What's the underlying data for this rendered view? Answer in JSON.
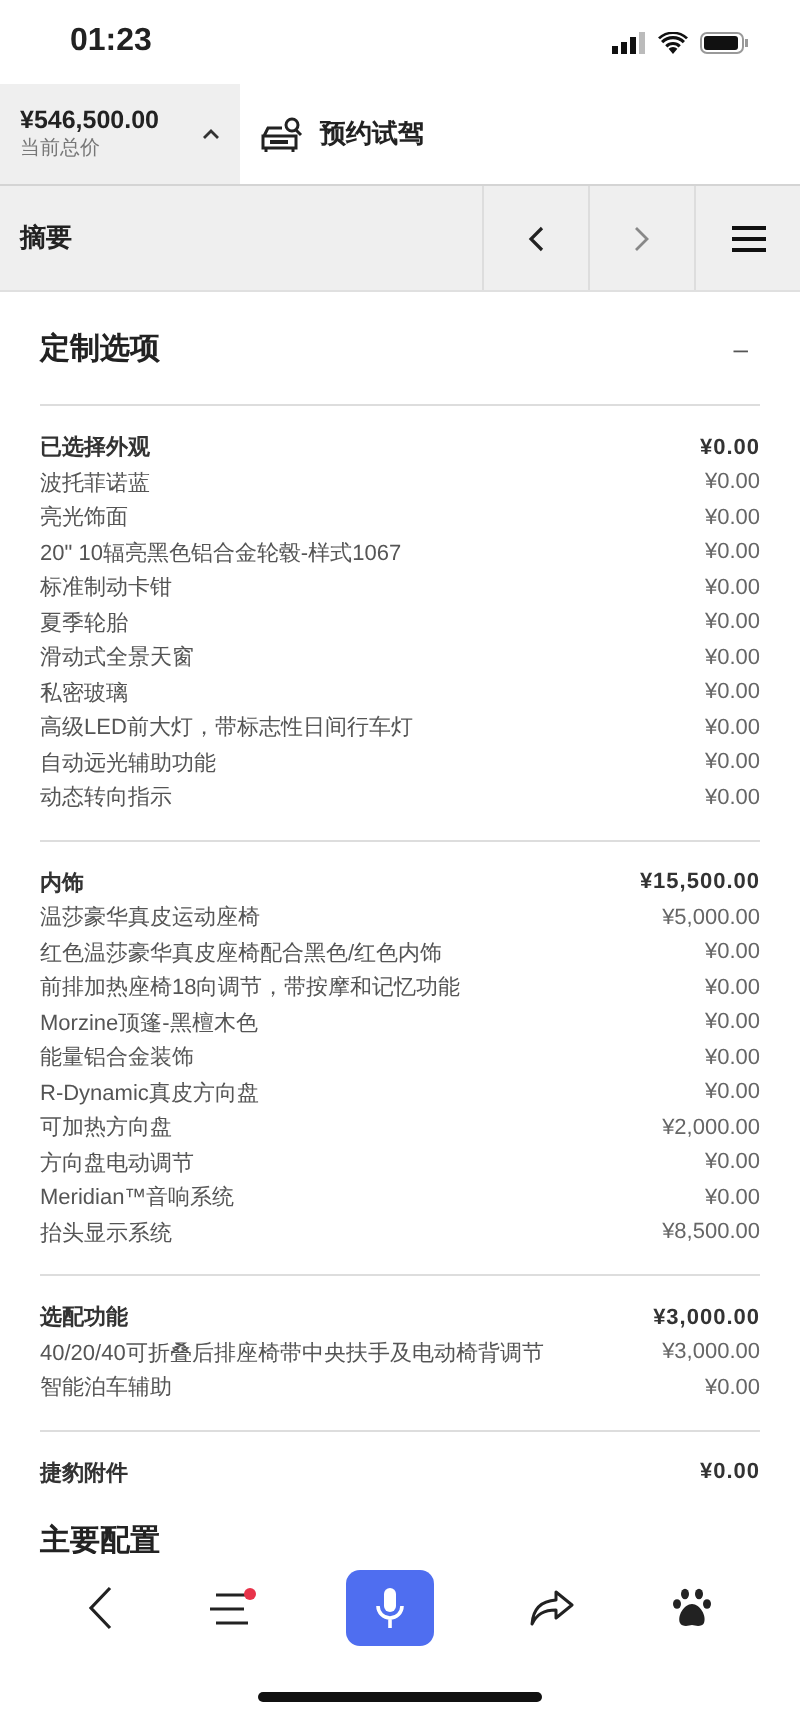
{
  "status_bar": {
    "time": "01:23"
  },
  "price_bar": {
    "total": "¥546,500.00",
    "total_label": "当前总价",
    "test_drive": "预约试驾"
  },
  "nav": {
    "title": "摘要"
  },
  "section": {
    "title": "定制选项",
    "collapse_symbol": "–"
  },
  "groups": [
    {
      "title": "已选择外观",
      "total": "¥0.00",
      "items": [
        {
          "name": "波托菲诺蓝",
          "price": "¥0.00"
        },
        {
          "name": "亮光饰面",
          "price": "¥0.00"
        },
        {
          "name": "20\" 10辐亮黑色铝合金轮毂-样式1067",
          "price": "¥0.00"
        },
        {
          "name": "标准制动卡钳",
          "price": "¥0.00"
        },
        {
          "name": "夏季轮胎",
          "price": "¥0.00"
        },
        {
          "name": "滑动式全景天窗",
          "price": "¥0.00"
        },
        {
          "name": "私密玻璃",
          "price": "¥0.00"
        },
        {
          "name": "高级LED前大灯，带标志性日间行车灯",
          "price": "¥0.00"
        },
        {
          "name": "自动远光辅助功能",
          "price": "¥0.00"
        },
        {
          "name": "动态转向指示",
          "price": "¥0.00"
        }
      ]
    },
    {
      "title": "内饰",
      "total": "¥15,500.00",
      "items": [
        {
          "name": "温莎豪华真皮运动座椅",
          "price": "¥5,000.00"
        },
        {
          "name": "红色温莎豪华真皮座椅配合黑色/红色内饰",
          "price": "¥0.00"
        },
        {
          "name": "前排加热座椅18向调节，带按摩和记忆功能",
          "price": "¥0.00"
        },
        {
          "name": "Morzine顶篷-黑檀木色",
          "price": "¥0.00"
        },
        {
          "name": "能量铝合金装饰",
          "price": "¥0.00"
        },
        {
          "name": "R-Dynamic真皮方向盘",
          "price": "¥0.00"
        },
        {
          "name": "可加热方向盘",
          "price": "¥2,000.00"
        },
        {
          "name": "方向盘电动调节",
          "price": "¥0.00"
        },
        {
          "name": "Meridian™音响系统",
          "price": "¥0.00"
        },
        {
          "name": "抬头显示系统",
          "price": "¥8,500.00"
        }
      ]
    },
    {
      "title": "选配功能",
      "total": "¥3,000.00",
      "items": [
        {
          "name": "40/20/40可折叠后排座椅带中央扶手及电动椅背调节",
          "price": "¥3,000.00"
        },
        {
          "name": "智能泊车辅助",
          "price": "¥0.00"
        }
      ]
    },
    {
      "title": "捷豹附件",
      "total": "¥0.00"
    }
  ],
  "next_section_title": "主要配置",
  "bottom_nav": {
    "menu_has_badge": true
  }
}
